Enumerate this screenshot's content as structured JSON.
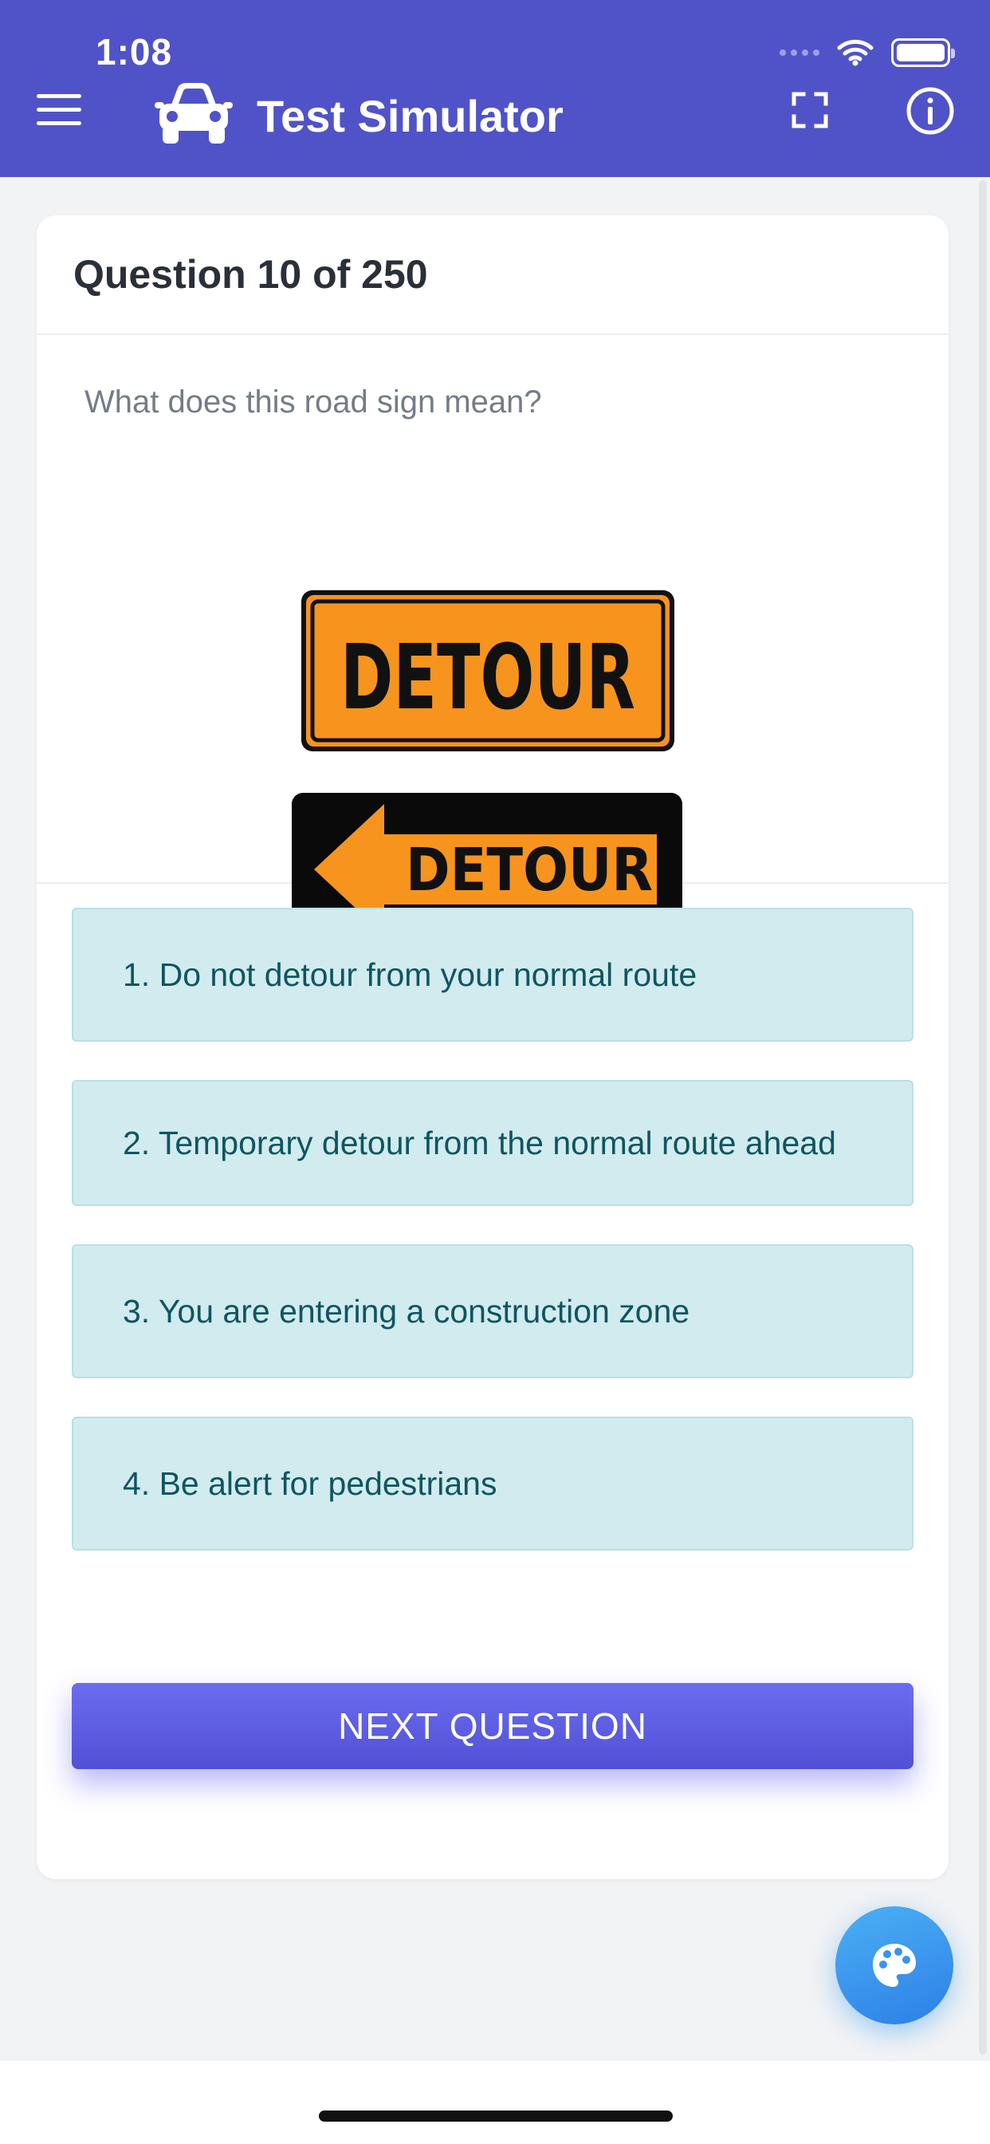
{
  "status_bar": {
    "time": "1:08"
  },
  "header": {
    "title": "Test Simulator",
    "menu_icon": "menu-icon",
    "logo_icon": "car-icon",
    "fullscreen_icon": "fullscreen-icon",
    "info_icon": "info-icon",
    "background_color": "#5053c8"
  },
  "quiz": {
    "title": "Question 10 of 250",
    "question": "What does this road sign mean?",
    "sign_texts": [
      "DETOUR",
      "DETOUR"
    ],
    "answers": [
      "1. Do not detour from your normal route",
      "2. Temporary detour from the normal route ahead",
      "3. You are entering a construction zone",
      "4. Be alert for pedestrians"
    ],
    "next_button": "NEXT QUESTION"
  },
  "fab": {
    "icon": "palette-icon"
  },
  "colors": {
    "answer_background": "#d1ebef",
    "answer_text": "#0f5560",
    "button": "#5a5ae0",
    "sign_orange": "#f7941d"
  }
}
